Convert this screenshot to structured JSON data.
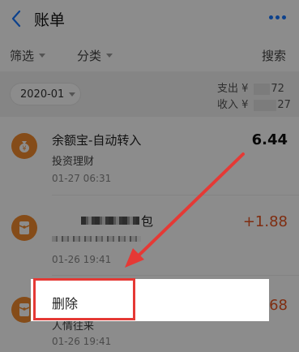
{
  "header": {
    "title": "账单",
    "back_icon": "back-chevron-icon",
    "more_icon": "more-dots-icon",
    "accent": "#1677ff"
  },
  "filters": {
    "filter_label": "筛选",
    "category_label": "分类",
    "search_label": "搜索"
  },
  "month": {
    "selected": "2020-01"
  },
  "summary": {
    "expense_label": "支出 ¥",
    "expense_value_visible": "72",
    "income_label": "收入 ¥",
    "income_value_visible": "27"
  },
  "records": [
    {
      "title": "余额宝-自动转入",
      "subtitle": "投资理财",
      "time": "01-27   06:31",
      "amount": "6.44",
      "icon": "money-bag-icon"
    },
    {
      "title_visible": "包",
      "time": "01-26   19:41",
      "amount": "+1.88",
      "icon": "red-packet-icon"
    },
    {
      "subtitle": "人情往来",
      "time": "01-26   19:41",
      "amount_visible": "68",
      "icon": "red-packet-icon"
    }
  ],
  "context_menu": {
    "delete_label": "删除"
  },
  "colors": {
    "amount_positive": "#e8531f",
    "annotation": "#e53935",
    "icon_bg": "#f28a2f"
  }
}
